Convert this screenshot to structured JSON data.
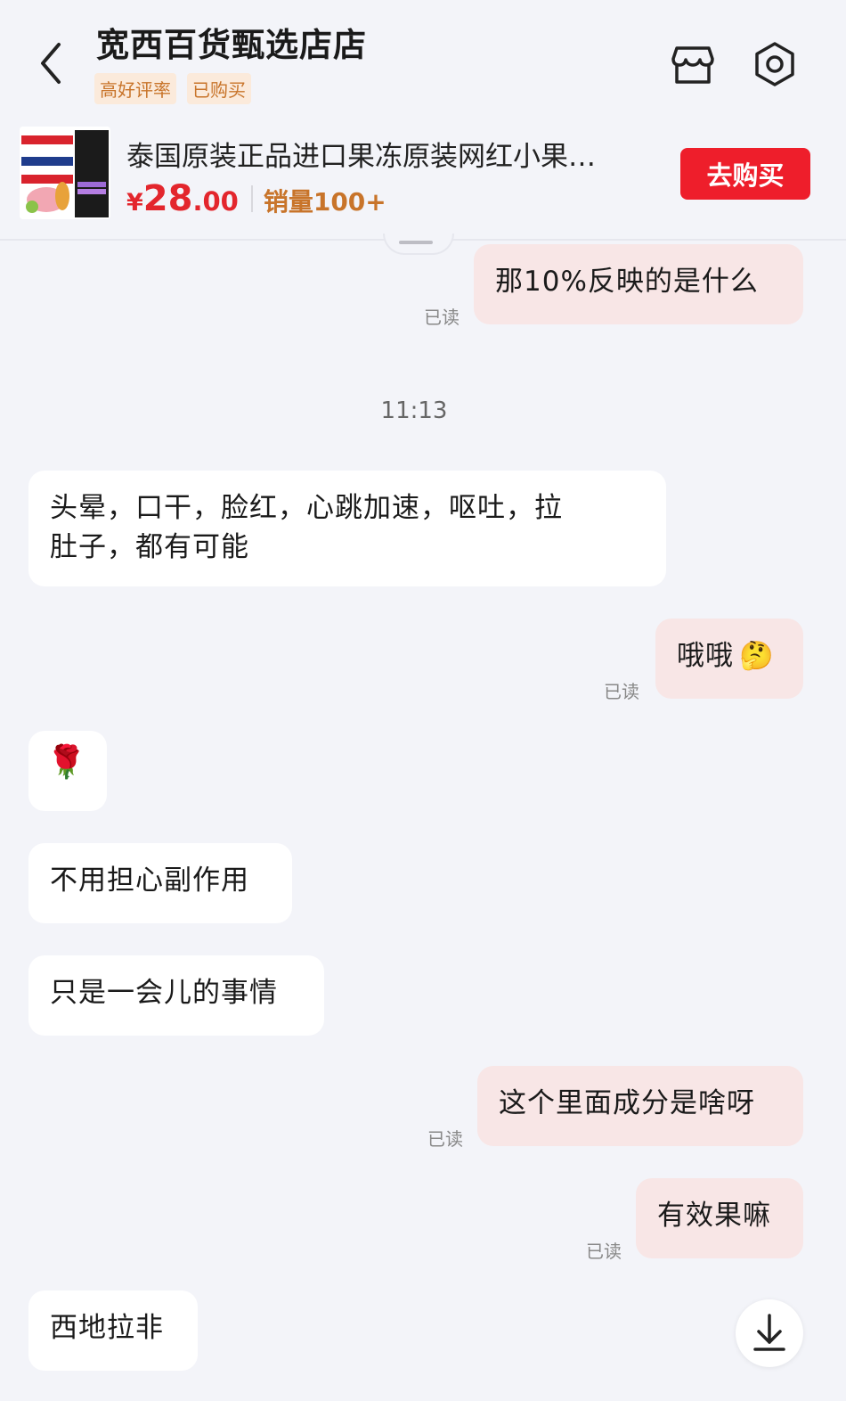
{
  "header": {
    "shop_name": "宽西百货甄选店店",
    "tags": [
      "高好评率",
      "已购买"
    ]
  },
  "product": {
    "title": "泰国原装正品进口果冻原装网红小果…",
    "price_symbol": "¥",
    "price_int": "28",
    "price_dec": ".00",
    "sales": "销量100+",
    "buy_label": "去购买"
  },
  "messages": {
    "m1": {
      "text": "那10%反映的是什么",
      "status": "已读"
    },
    "time": "11:13",
    "m2": {
      "text_line1": "头晕，口干，脸红，心跳加速，呕吐，拉",
      "text_line2": "肚子，都有可能"
    },
    "m3": {
      "text": "哦哦",
      "emoji": "🤔",
      "status": "已读"
    },
    "m4": {
      "emoji": "🌹"
    },
    "m5": {
      "text": "不用担心副作用"
    },
    "m6": {
      "text": "只是一会儿的事情"
    },
    "m7": {
      "text": "这个里面成分是啥呀",
      "status": "已读"
    },
    "m8": {
      "text": "有效果嘛",
      "status": "已读"
    },
    "m9": {
      "text": "西地拉非"
    }
  },
  "colors": {
    "accent": "#ee1e2b",
    "outgoing_bubble": "#f8e6e6",
    "incoming_bubble": "#ffffff",
    "tag_text": "#c8742a"
  },
  "icons": [
    "back-icon",
    "store-icon",
    "settings-icon",
    "scroll-down-icon"
  ]
}
